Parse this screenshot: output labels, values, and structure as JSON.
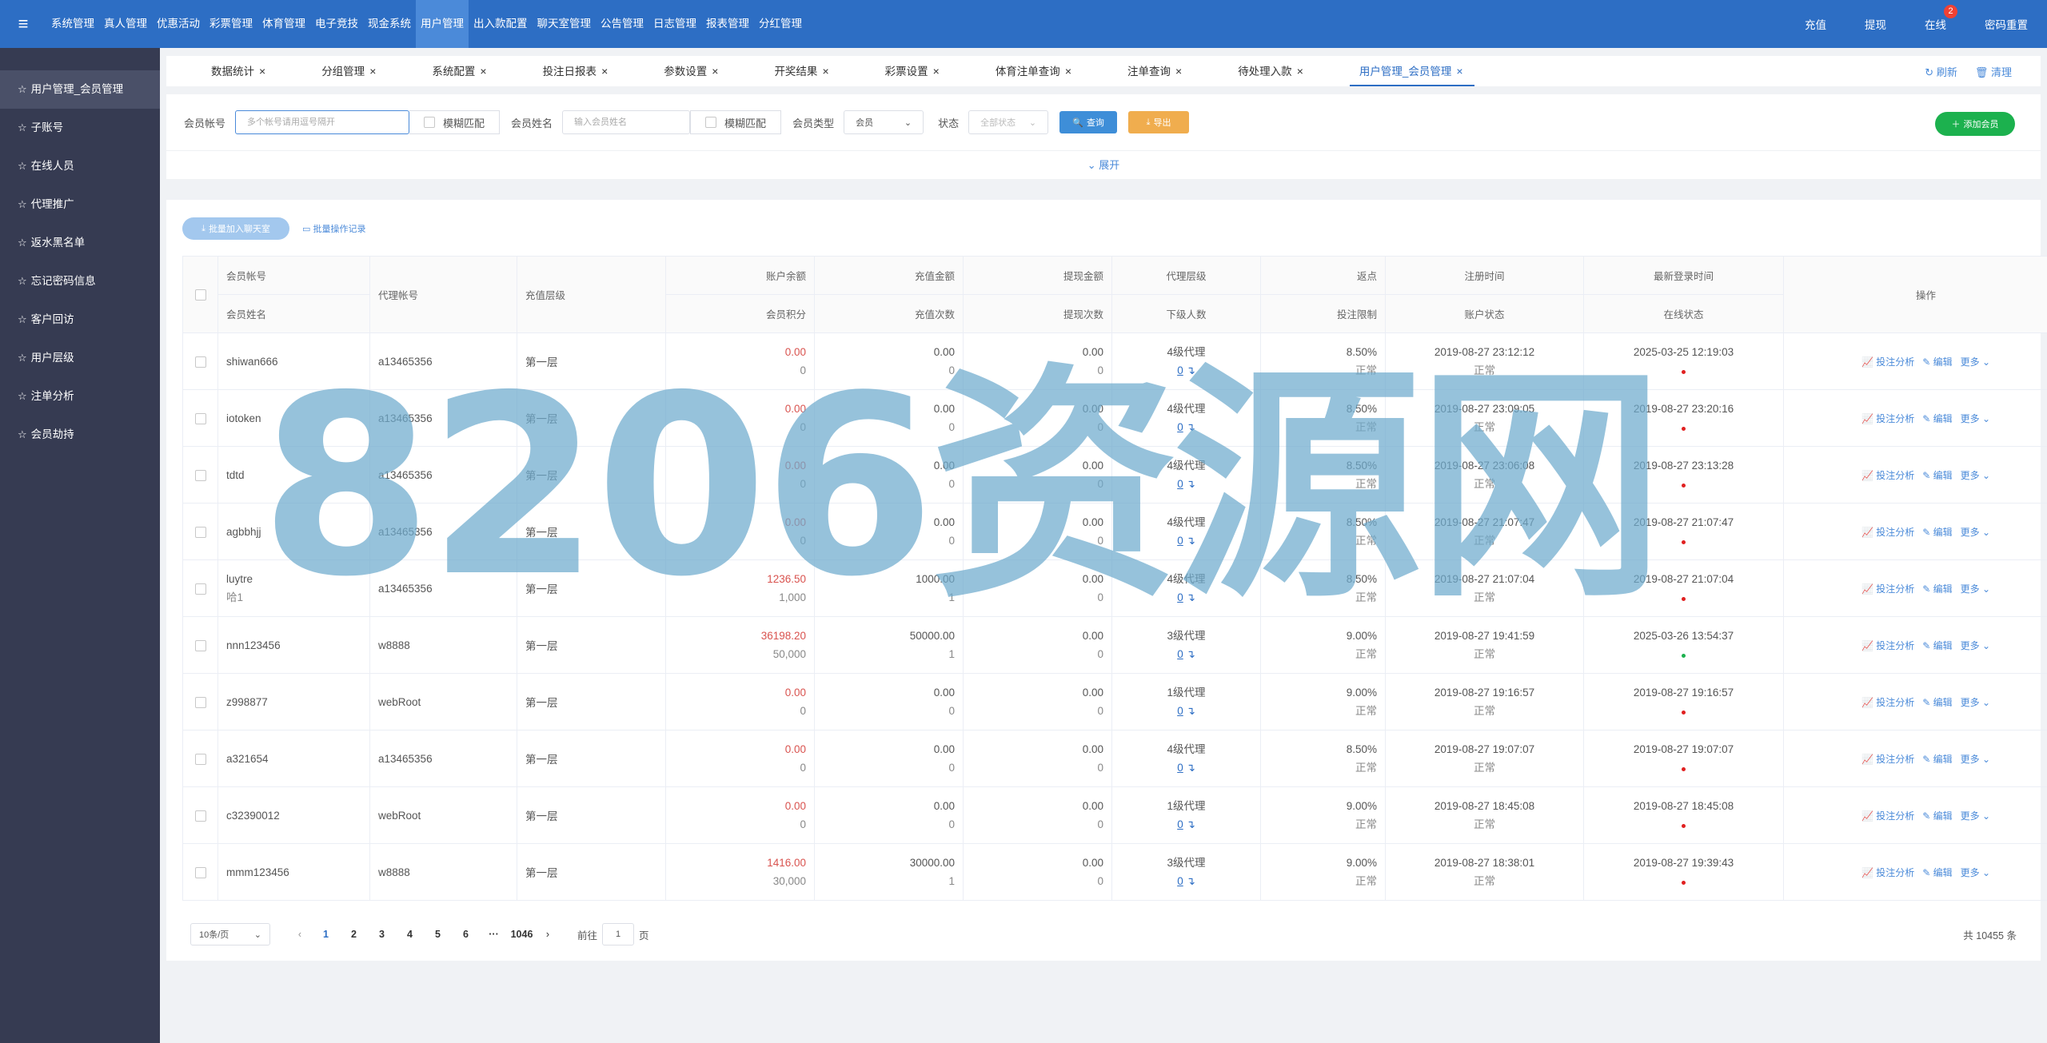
{
  "topbar": {
    "menu_icon": "hamburger-icon",
    "nav": [
      "系统管理",
      "真人管理",
      "优惠活动",
      "彩票管理",
      "体育管理",
      "电子竞技",
      "现金系统",
      "用户管理",
      "出入款配置",
      "聊天室管理",
      "公告管理",
      "日志管理",
      "报表管理",
      "分红管理"
    ],
    "active_nav": "用户管理",
    "right": {
      "recharge": "充值",
      "withdraw": "提现",
      "online": "在线",
      "online_badge": "2",
      "password_reset": "密码重置"
    }
  },
  "sidebar": {
    "items": [
      "用户管理_会员管理",
      "子账号",
      "在线人员",
      "代理推广",
      "返水黑名单",
      "忘记密码信息",
      "客户回访",
      "用户层级",
      "注单分析",
      "会员劫持"
    ],
    "active": "用户管理_会员管理"
  },
  "tabs": {
    "items": [
      "数据统计",
      "分组管理",
      "系统配置",
      "投注日报表",
      "参数设置",
      "开奖结果",
      "彩票设置",
      "体育注单查询",
      "注单查询",
      "待处理入款",
      "用户管理_会员管理"
    ],
    "active": "用户管理_会员管理",
    "refresh": "刷新",
    "clear": "清理"
  },
  "filter": {
    "account_label": "会员帐号",
    "account_placeholder": "多个帐号请用逗号隔开",
    "fuzzy_label": "模糊匹配",
    "name_label": "会员姓名",
    "name_placeholder": "输入会员姓名",
    "fuzzy_label2": "模糊匹配",
    "type_label": "会员类型",
    "type_value": "会员",
    "status_label": "状态",
    "status_value": "全部状态",
    "search_button": "查询",
    "export_button": "导出",
    "add_button": "添加会员",
    "expand": "展开"
  },
  "batch": {
    "join_chat": "批量加入聊天室",
    "log": "批量操作记录"
  },
  "table": {
    "headers": {
      "account": "会员帐号",
      "name": "会员姓名",
      "agent": "代理帐号",
      "level": "充值层级",
      "balance": "账户余额",
      "points": "会员积分",
      "deposit": "充值金额",
      "deposit_count": "充值次数",
      "withdraw": "提现金额",
      "withdraw_count": "提现次数",
      "agent_level": "代理层级",
      "sub_count": "下级人数",
      "rebate": "返点",
      "bet_limit": "投注限制",
      "reg_time": "注册时间",
      "acct_status": "账户状态",
      "last_login": "最新登录时间",
      "online_status": "在线状态",
      "ops": "操作"
    },
    "ops": {
      "analysis": "投注分析",
      "edit": "编辑",
      "more": "更多"
    },
    "rows": [
      {
        "account": "shiwan666",
        "name": "",
        "agent": "a13465356",
        "level": "第一层",
        "balance": "0.00",
        "points": "0",
        "deposit": "0.00",
        "deposit_count": "0",
        "withdraw": "0.00",
        "withdraw_count": "0",
        "agent_level": "4级代理",
        "sub_count": "0",
        "rebate": "8.50%",
        "bet_limit": "正常",
        "reg_time": "2019-08-27 23:12:12",
        "acct_status": "正常",
        "last_login": "2025-03-25 12:19:03",
        "online": "offline"
      },
      {
        "account": "iotoken",
        "name": "",
        "agent": "a13465356",
        "level": "第一层",
        "balance": "0.00",
        "points": "0",
        "deposit": "0.00",
        "deposit_count": "0",
        "withdraw": "0.00",
        "withdraw_count": "0",
        "agent_level": "4级代理",
        "sub_count": "0",
        "rebate": "8.50%",
        "bet_limit": "正常",
        "reg_time": "2019-08-27 23:09:05",
        "acct_status": "正常",
        "last_login": "2019-08-27 23:20:16",
        "online": "offline"
      },
      {
        "account": "tdtd",
        "name": "",
        "agent": "a13465356",
        "level": "第一层",
        "balance": "0.00",
        "points": "0",
        "deposit": "0.00",
        "deposit_count": "0",
        "withdraw": "0.00",
        "withdraw_count": "0",
        "agent_level": "4级代理",
        "sub_count": "0",
        "rebate": "8.50%",
        "bet_limit": "正常",
        "reg_time": "2019-08-27 23:06:08",
        "acct_status": "正常",
        "last_login": "2019-08-27 23:13:28",
        "online": "offline"
      },
      {
        "account": "agbbhjj",
        "name": "",
        "agent": "a13465356",
        "level": "第一层",
        "balance": "0.00",
        "points": "0",
        "deposit": "0.00",
        "deposit_count": "0",
        "withdraw": "0.00",
        "withdraw_count": "0",
        "agent_level": "4级代理",
        "sub_count": "0",
        "rebate": "8.50%",
        "bet_limit": "正常",
        "reg_time": "2019-08-27 21:07:47",
        "acct_status": "正常",
        "last_login": "2019-08-27 21:07:47",
        "online": "offline"
      },
      {
        "account": "luytre",
        "name": "哈1",
        "agent": "a13465356",
        "level": "第一层",
        "balance": "1236.50",
        "points": "1,000",
        "deposit": "1000.00",
        "deposit_count": "1",
        "withdraw": "0.00",
        "withdraw_count": "0",
        "agent_level": "4级代理",
        "sub_count": "0",
        "rebate": "8.50%",
        "bet_limit": "正常",
        "reg_time": "2019-08-27 21:07:04",
        "acct_status": "正常",
        "last_login": "2019-08-27 21:07:04",
        "online": "offline"
      },
      {
        "account": "nnn123456",
        "name": "",
        "agent": "w8888",
        "level": "第一层",
        "balance": "36198.20",
        "points": "50,000",
        "deposit": "50000.00",
        "deposit_count": "1",
        "withdraw": "0.00",
        "withdraw_count": "0",
        "agent_level": "3级代理",
        "sub_count": "0",
        "rebate": "9.00%",
        "bet_limit": "正常",
        "reg_time": "2019-08-27 19:41:59",
        "acct_status": "正常",
        "last_login": "2025-03-26 13:54:37",
        "online": "online"
      },
      {
        "account": "z998877",
        "name": "",
        "agent": "webRoot",
        "level": "第一层",
        "balance": "0.00",
        "points": "0",
        "deposit": "0.00",
        "deposit_count": "0",
        "withdraw": "0.00",
        "withdraw_count": "0",
        "agent_level": "1级代理",
        "sub_count": "0",
        "rebate": "9.00%",
        "bet_limit": "正常",
        "reg_time": "2019-08-27 19:16:57",
        "acct_status": "正常",
        "last_login": "2019-08-27 19:16:57",
        "online": "offline"
      },
      {
        "account": "a321654",
        "name": "",
        "agent": "a13465356",
        "level": "第一层",
        "balance": "0.00",
        "points": "0",
        "deposit": "0.00",
        "deposit_count": "0",
        "withdraw": "0.00",
        "withdraw_count": "0",
        "agent_level": "4级代理",
        "sub_count": "0",
        "rebate": "8.50%",
        "bet_limit": "正常",
        "reg_time": "2019-08-27 19:07:07",
        "acct_status": "正常",
        "last_login": "2019-08-27 19:07:07",
        "online": "offline"
      },
      {
        "account": "c32390012",
        "name": "",
        "agent": "webRoot",
        "level": "第一层",
        "balance": "0.00",
        "points": "0",
        "deposit": "0.00",
        "deposit_count": "0",
        "withdraw": "0.00",
        "withdraw_count": "0",
        "agent_level": "1级代理",
        "sub_count": "0",
        "rebate": "9.00%",
        "bet_limit": "正常",
        "reg_time": "2019-08-27 18:45:08",
        "acct_status": "正常",
        "last_login": "2019-08-27 18:45:08",
        "online": "offline"
      },
      {
        "account": "mmm123456",
        "name": "",
        "agent": "w8888",
        "level": "第一层",
        "balance": "1416.00",
        "points": "30,000",
        "deposit": "30000.00",
        "deposit_count": "1",
        "withdraw": "0.00",
        "withdraw_count": "0",
        "agent_level": "3级代理",
        "sub_count": "0",
        "rebate": "9.00%",
        "bet_limit": "正常",
        "reg_time": "2019-08-27 18:38:01",
        "acct_status": "正常",
        "last_login": "2019-08-27 19:39:43",
        "online": "offline"
      }
    ]
  },
  "pagination": {
    "page_size": "10条/页",
    "pages": [
      "1",
      "2",
      "3",
      "4",
      "5",
      "6",
      "···",
      "1046"
    ],
    "current": "1",
    "goto_label": "前往",
    "goto_value": "1",
    "goto_suffix": "页",
    "total": "共 10455 条"
  },
  "watermark": "8206资源网",
  "colors": {
    "primary": "#2d6ec4",
    "sidebar": "#363b52",
    "danger": "#d9534f",
    "success": "#1cb14e",
    "offline_dot": "#e02020",
    "online_dot": "#1cb14e"
  }
}
